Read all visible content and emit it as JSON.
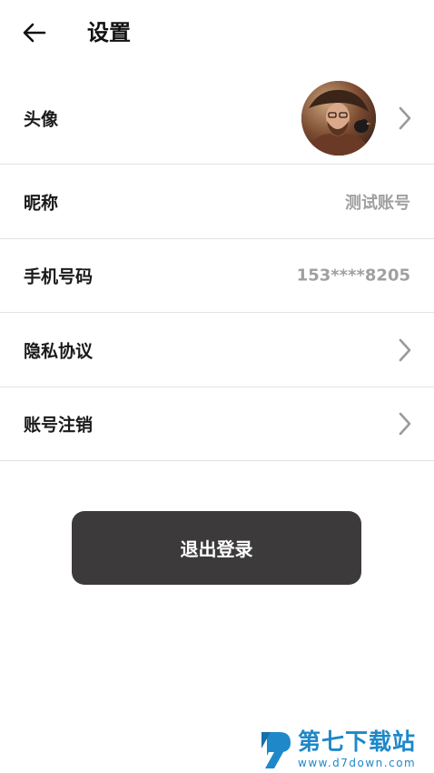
{
  "header": {
    "title": "设置",
    "back_icon": "arrow-left-icon"
  },
  "rows": [
    {
      "label": "头像",
      "type": "avatar",
      "icon": "chevron-right-icon"
    },
    {
      "label": "昵称",
      "value": "测试账号"
    },
    {
      "label": "手机号码",
      "value": "153****8205"
    },
    {
      "label": "隐私协议",
      "icon": "chevron-right-icon"
    },
    {
      "label": "账号注销",
      "icon": "chevron-right-icon"
    }
  ],
  "logout": {
    "label": "退出登录",
    "color": "#3c3a3a"
  },
  "watermark": {
    "name": "第七下载站",
    "url": "www.d7down.com",
    "color": "#1e88c8"
  },
  "colors": {
    "divider": "#e3e3e3",
    "value_text": "#a0a0a0"
  }
}
